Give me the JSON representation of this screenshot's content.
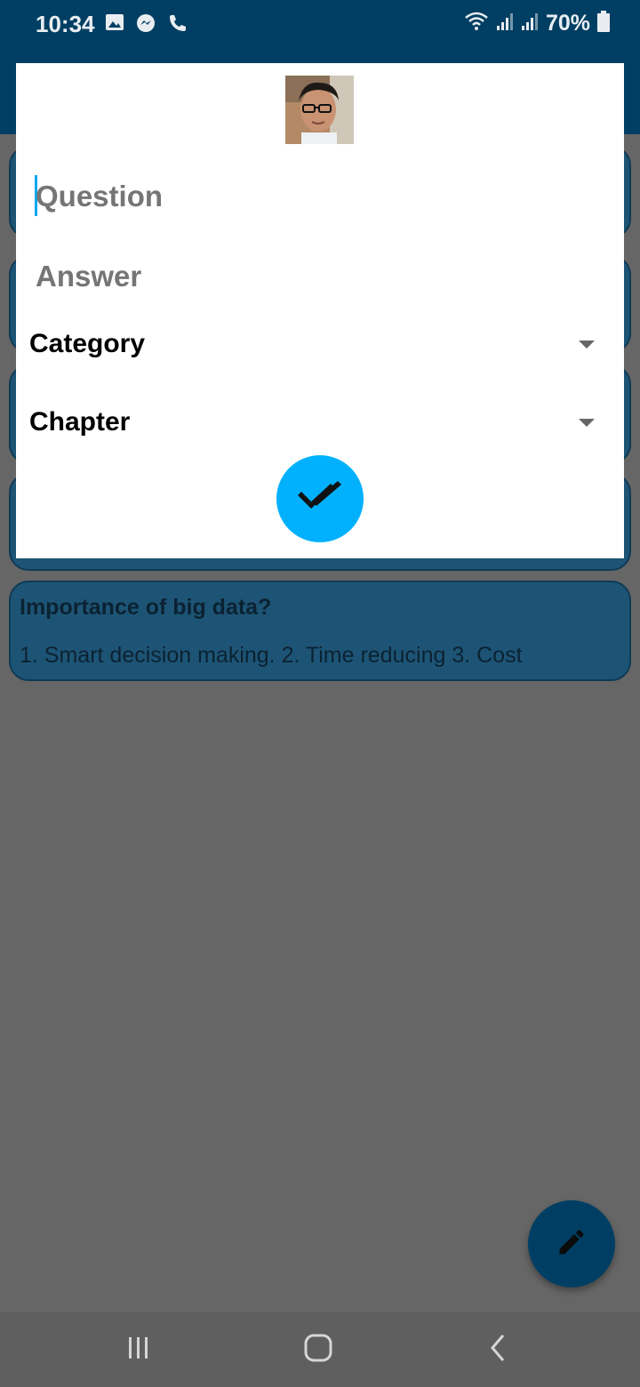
{
  "status_bar": {
    "time": "10:34",
    "battery": "70%",
    "icons_left": [
      "image-icon",
      "messenger-icon",
      "phone-icon"
    ],
    "icons_right": [
      "wifi-icon",
      "signal-icon",
      "signal-icon",
      "battery-icon"
    ]
  },
  "cards": [
    {
      "question": "",
      "answer": ""
    },
    {
      "question": "",
      "answer": ""
    },
    {
      "question": "",
      "answer": ""
    },
    {
      "question": "",
      "answer": ""
    },
    {
      "question": "Importance of big data?",
      "answer": "1. Smart decision making. 2. Time reducing 3. Cost"
    }
  ],
  "dialog": {
    "question_placeholder": "Question",
    "answer_placeholder": "Answer",
    "category_label": "Category",
    "chapter_label": "Chapter",
    "submit_icon": "double-check-icon"
  },
  "fab": {
    "icon": "pencil-icon"
  },
  "nav": {
    "icons": [
      "recent-apps-icon",
      "home-icon",
      "back-icon"
    ]
  },
  "colors": {
    "primary": "#003f63",
    "accent": "#02b1fe",
    "scrim_bg": "#666666",
    "card_bg": "#1d5475"
  }
}
